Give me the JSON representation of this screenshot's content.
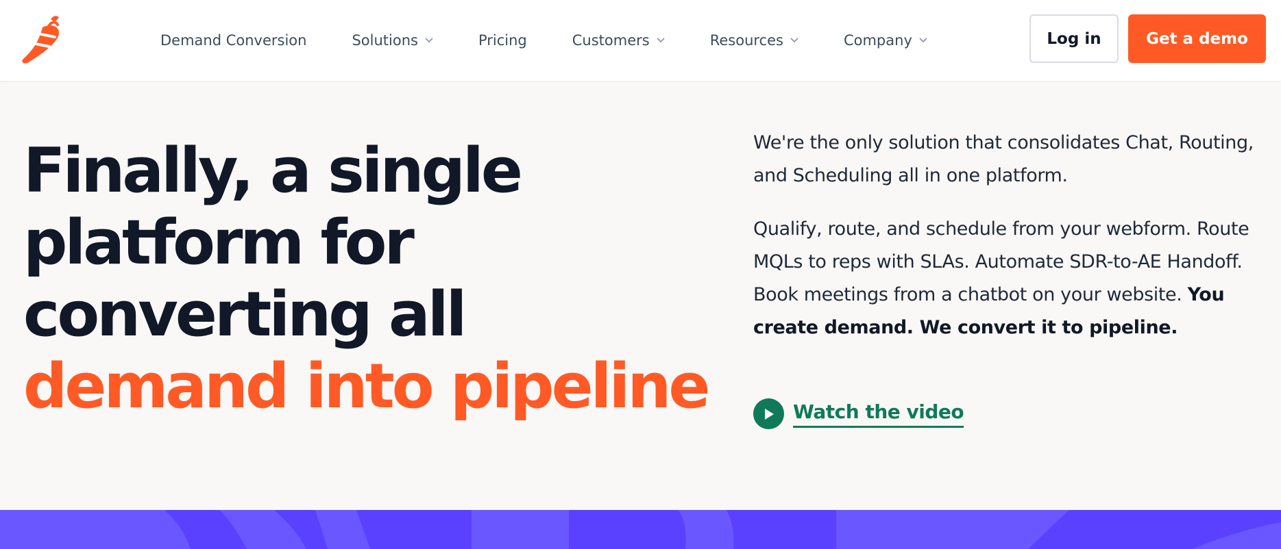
{
  "header": {
    "logo_icon": "chili-pepper-icon",
    "nav": [
      {
        "label": "Demand Conversion",
        "has_dropdown": false
      },
      {
        "label": "Solutions",
        "has_dropdown": true
      },
      {
        "label": "Pricing",
        "has_dropdown": false
      },
      {
        "label": "Customers",
        "has_dropdown": true
      },
      {
        "label": "Resources",
        "has_dropdown": true
      },
      {
        "label": "Company",
        "has_dropdown": true
      }
    ],
    "login_label": "Log in",
    "demo_label": "Get a demo"
  },
  "hero": {
    "title_lines": [
      "Finally, a single",
      "platform for",
      "converting all"
    ],
    "title_accent": "demand into pipeline",
    "paragraph1": "We're the only solution that consolidates Chat, Routing, and Scheduling all in one platform.",
    "paragraph2": "Qualify, route, and schedule from your webform. Route MQLs to reps with SLAs. Automate SDR-to-AE Handoff. Book meetings from a chatbot on your website.",
    "paragraph2_bold": "You create demand. We convert it to pipeline.",
    "watch_label": "Watch the video"
  },
  "colors": {
    "brand_orange": "#ff5a25",
    "heading_dark": "#111827",
    "link_green": "#0f7a5a",
    "band_purple": "#5a41ff"
  }
}
